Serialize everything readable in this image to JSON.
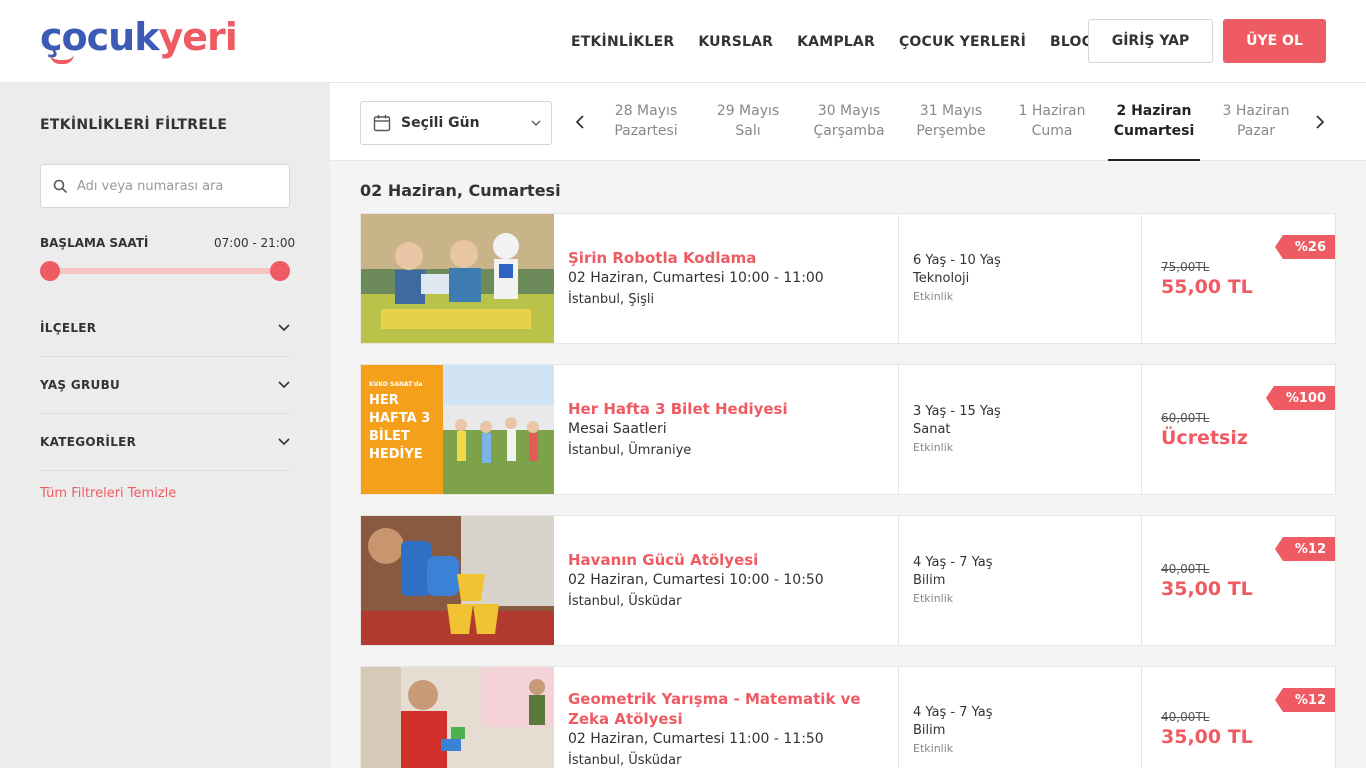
{
  "header": {
    "logo": {
      "part1": "çocuk",
      "part2": "yeri"
    },
    "nav": [
      "ETKİNLİKLER",
      "KURSLAR",
      "KAMPLAR",
      "ÇOCUK YERLERİ",
      "BLOG"
    ],
    "login_label": "GİRİŞ YAP",
    "signup_label": "ÜYE OL"
  },
  "sidebar": {
    "title": "ETKİNLİKLERİ FİLTRELE",
    "search_placeholder": "Adı veya numarası ara",
    "time_label": "BAŞLAMA SAATİ",
    "time_range": "07:00 - 21:00",
    "filters": [
      "İLÇELER",
      "YAŞ GRUBU",
      "KATEGORİLER"
    ],
    "clear_label": "Tüm Filtreleri Temizle"
  },
  "datebar": {
    "select_label": "Seçili Gün",
    "days": [
      {
        "date": "28 Mayıs",
        "day": "Pazartesi",
        "active": false
      },
      {
        "date": "29 Mayıs",
        "day": "Salı",
        "active": false
      },
      {
        "date": "30 Mayıs",
        "day": "Çarşamba",
        "active": false
      },
      {
        "date": "31 Mayıs",
        "day": "Perşembe",
        "active": false
      },
      {
        "date": "1 Haziran",
        "day": "Cuma",
        "active": false
      },
      {
        "date": "2 Haziran",
        "day": "Cumartesi",
        "active": true
      },
      {
        "date": "3 Haziran",
        "day": "Pazar",
        "active": false
      }
    ]
  },
  "main": {
    "section_title": "02 Haziran, Cumartesi",
    "events": [
      {
        "title": "Şirin Robotla Kodlama",
        "datetime": "02 Haziran, Cumartesi 10:00 - 11:00",
        "location": "İstanbul, Şişli",
        "age": "6 Yaş - 10 Yaş",
        "category": "Teknoloji",
        "type": "Etkinlik",
        "old_price": "75,00TL",
        "new_price": "55,00 TL",
        "discount": "%26"
      },
      {
        "title": "Her Hafta 3 Bilet Hediyesi",
        "datetime": "Mesai Saatleri",
        "location": "İstanbul, Ümraniye",
        "age": "3 Yaş - 15 Yaş",
        "category": "Sanat",
        "type": "Etkinlik",
        "old_price": "60,00TL",
        "new_price": "Ücretsiz",
        "discount": "%100",
        "image_text": {
          "small": "KUKO SANAT'da",
          "big": "HER HAFTA 3 BİLET HEDİYE"
        }
      },
      {
        "title": "Havanın Gücü Atölyesi",
        "datetime": "02 Haziran, Cumartesi 10:00 - 10:50",
        "location": "İstanbul, Üsküdar",
        "age": "4 Yaş - 7 Yaş",
        "category": "Bilim",
        "type": "Etkinlik",
        "old_price": "40,00TL",
        "new_price": "35,00 TL",
        "discount": "%12"
      },
      {
        "title": "Geometrik Yarışma - Matematik ve Zeka Atölyesi",
        "datetime": "02 Haziran, Cumartesi 11:00 - 11:50",
        "location": "İstanbul, Üsküdar",
        "age": "4 Yaş - 7 Yaş",
        "category": "Bilim",
        "type": "Etkinlik",
        "old_price": "40,00TL",
        "new_price": "35,00 TL",
        "discount": "%12"
      }
    ]
  },
  "colors": {
    "accent": "#ef5b63",
    "logo_blue": "#3b5bb5"
  }
}
